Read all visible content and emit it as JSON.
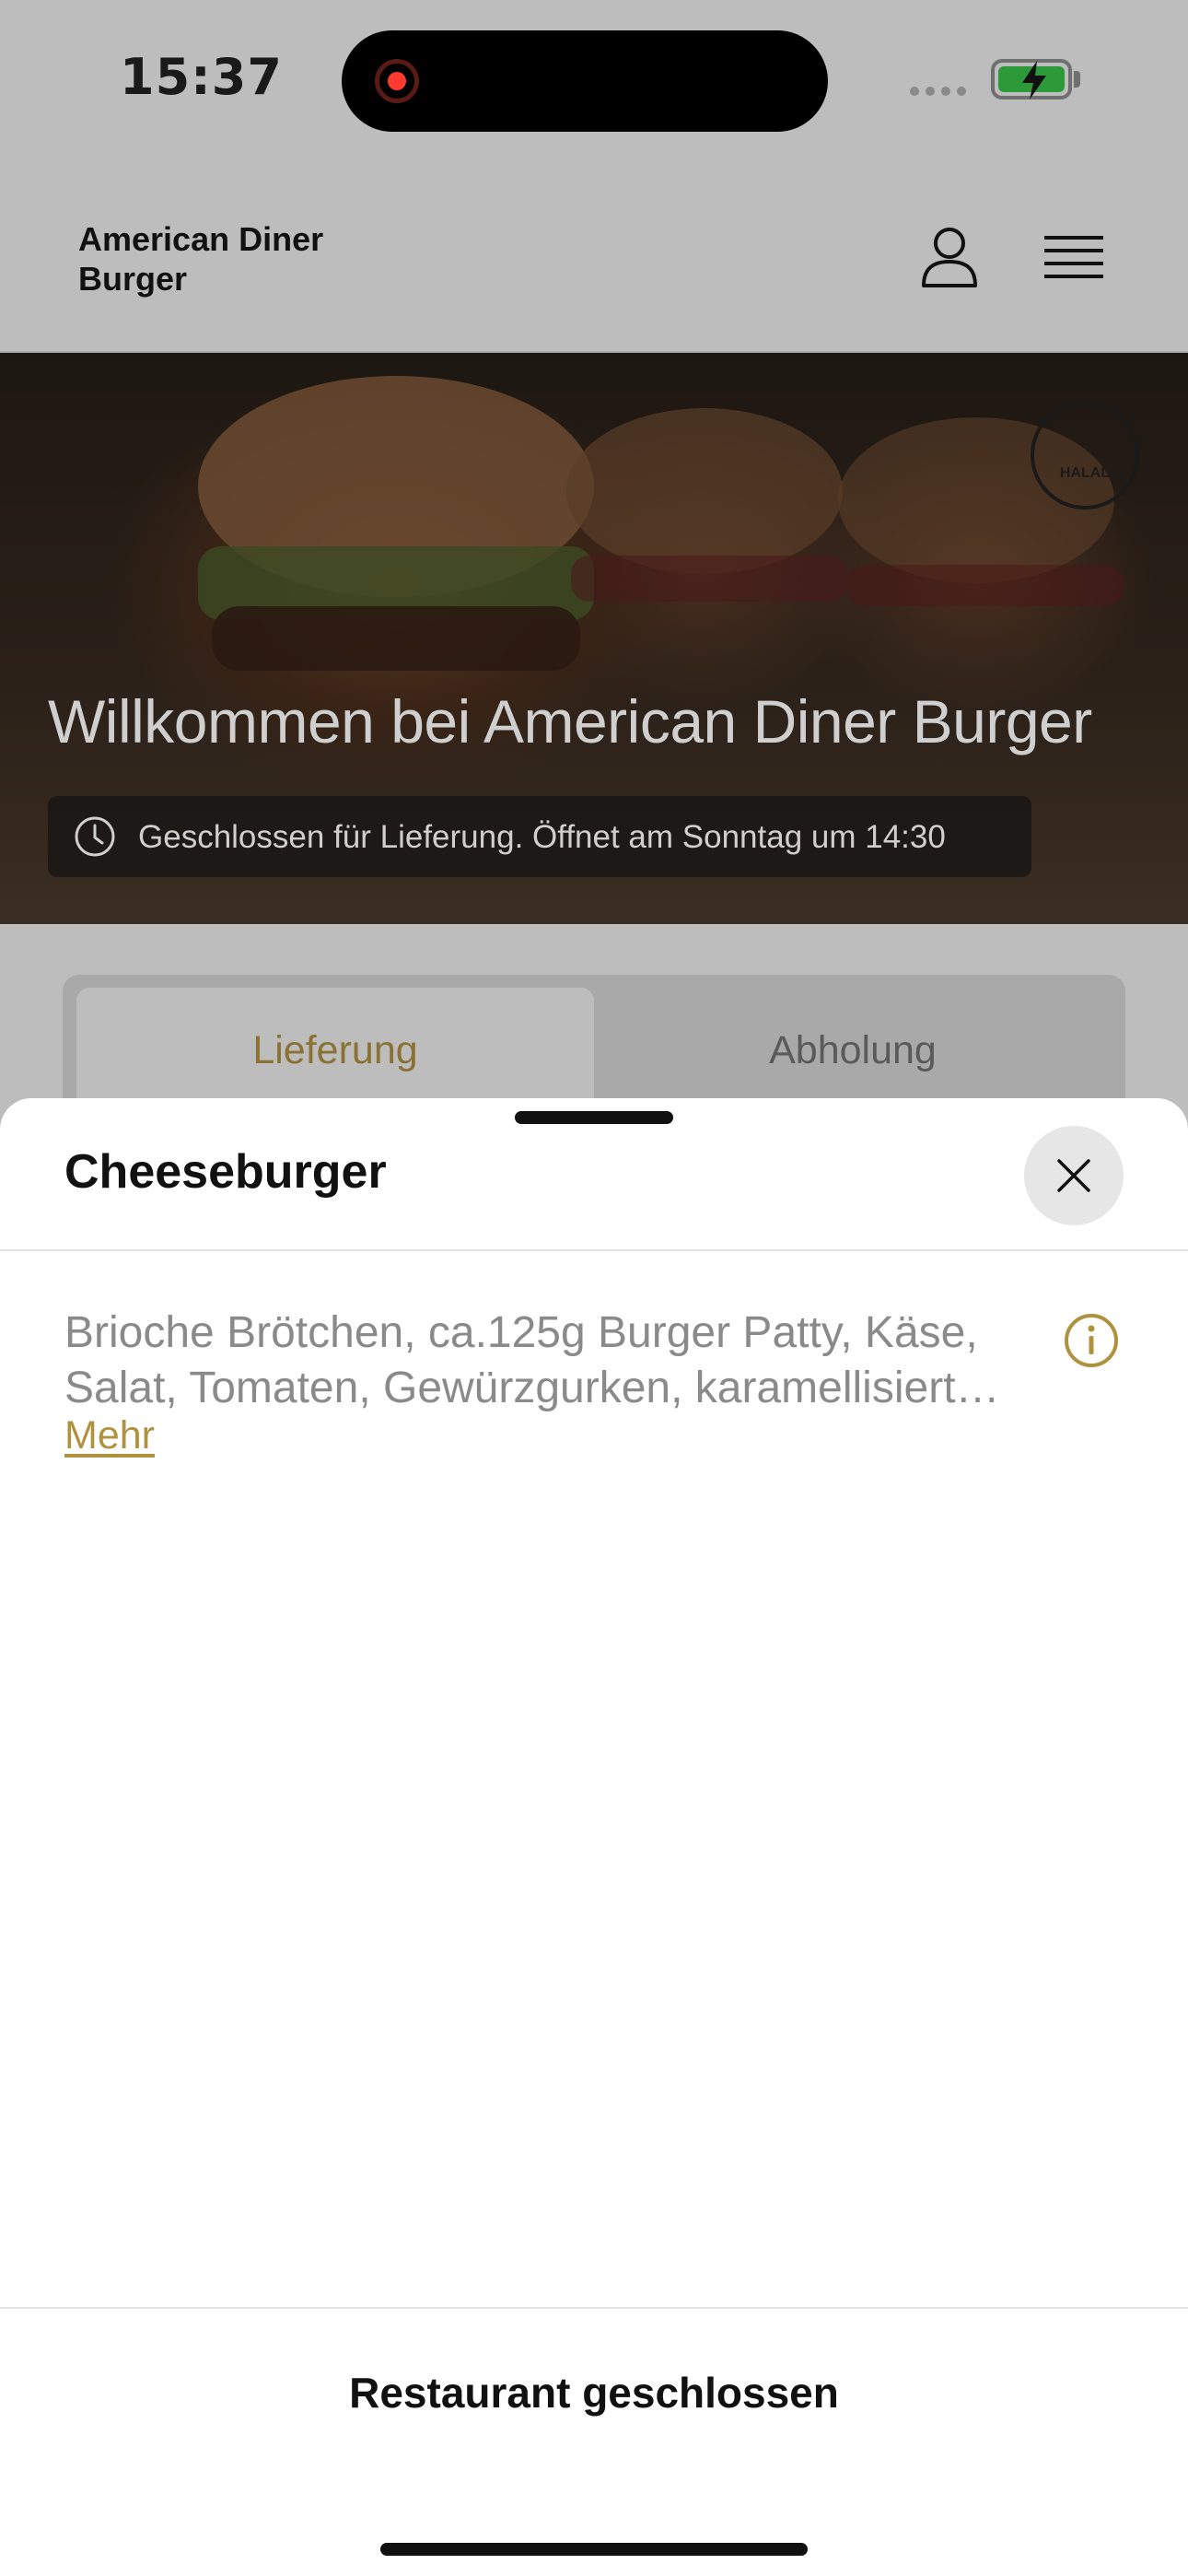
{
  "status_bar": {
    "time": "15:37"
  },
  "header": {
    "brand": "American Diner Burger"
  },
  "hero": {
    "badge": "HALAL",
    "title": "Willkommen bei American Diner Burger",
    "status": "Geschlossen für Lieferung. Öffnet am Sonntag um 14:30"
  },
  "tabs": [
    {
      "label": "Lieferung",
      "active": true
    },
    {
      "label": "Abholung",
      "active": false
    }
  ],
  "sheet": {
    "title": "Cheeseburger",
    "description_line1": "Brioche Brötchen, ca.125g Burger Patty, Käse,",
    "description_line2": "Salat, Tomaten, Gewürzgurken, karamellisiert…",
    "more_label": "Mehr",
    "footer_label": "Restaurant geschlossen"
  },
  "colors": {
    "accent": "#b0913e",
    "overlay": "#bdbdbd",
    "battery_green": "#2d9a3a",
    "record_red": "#ff3b30"
  },
  "icons": [
    "user-icon",
    "menu-icon",
    "clock-icon",
    "close-icon",
    "info-icon",
    "halal-icon",
    "battery-icon",
    "recording-icon"
  ]
}
